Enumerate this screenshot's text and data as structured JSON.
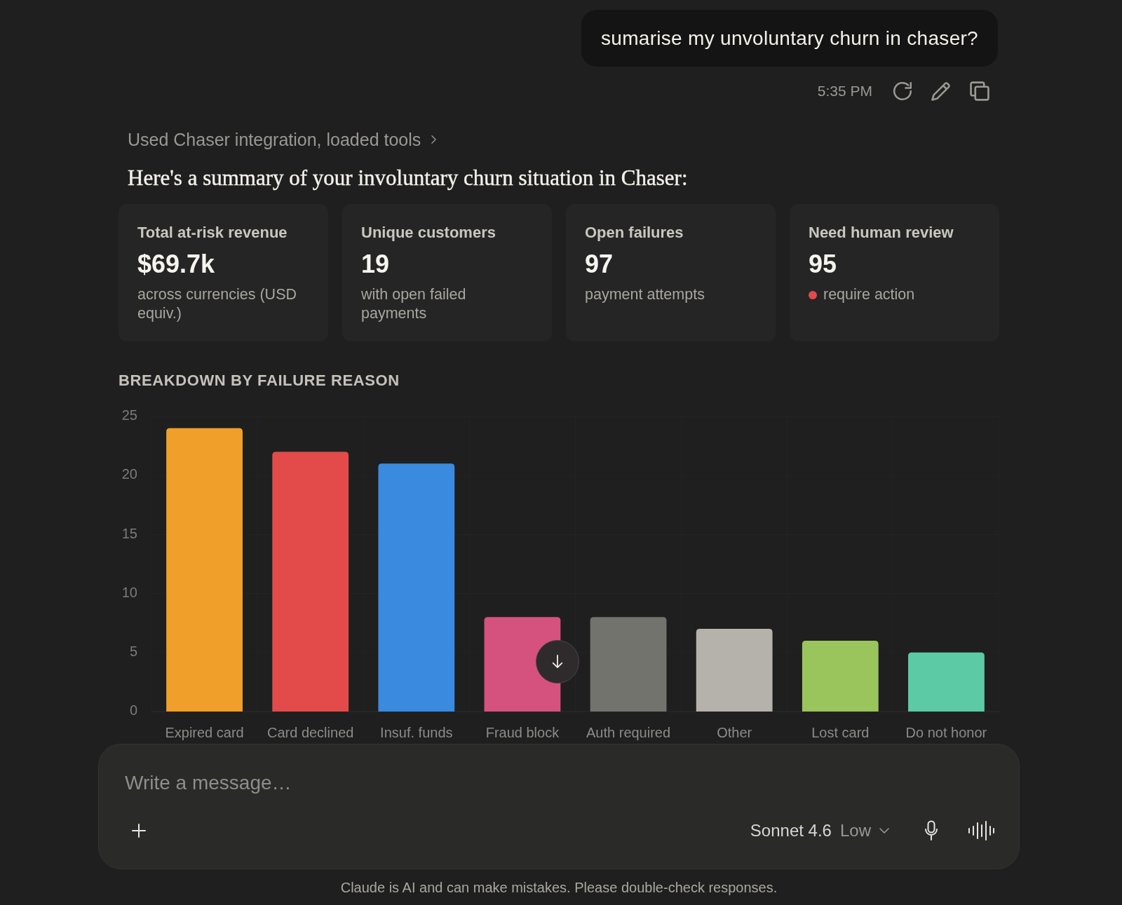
{
  "user_message": {
    "text": "sumarise my unvoluntary churn in chaser?",
    "time": "5:35 PM"
  },
  "tool_use": {
    "label": "Used Chaser integration, loaded tools"
  },
  "response": {
    "heading": "Here's a summary of your involuntary churn situation in Chaser:",
    "cards": [
      {
        "label": "Total at-risk revenue",
        "value": "$69.7k",
        "note": "across currencies (USD equiv.)",
        "alert": false
      },
      {
        "label": "Unique customers",
        "value": "19",
        "note": "with open failed payments",
        "alert": false
      },
      {
        "label": "Open failures",
        "value": "97",
        "note": "payment attempts",
        "alert": false
      },
      {
        "label": "Need human review",
        "value": "95",
        "note": "require action",
        "alert": true
      }
    ],
    "chart_data": {
      "type": "bar",
      "title": "BREAKDOWN BY FAILURE REASON",
      "categories": [
        "Expired card",
        "Card declined",
        "Insuf. funds",
        "Fraud block",
        "Auth required",
        "Other",
        "Lost card",
        "Do not honor"
      ],
      "values": [
        24,
        22,
        21,
        8,
        8,
        7,
        6,
        5
      ],
      "colors": [
        "#f0a02a",
        "#e24b4a",
        "#3a8ae0",
        "#d6527e",
        "#73736d",
        "#b4b2aa",
        "#9ac45c",
        "#5ccaa5"
      ],
      "ylim": [
        0,
        25
      ],
      "yticks": [
        0,
        5,
        10,
        15,
        20,
        25
      ]
    }
  },
  "composer": {
    "placeholder": "Write a message…",
    "model": "Sonnet 4.6",
    "effort": "Low"
  },
  "disclaimer": "Claude is AI and can make mistakes. Please double-check responses."
}
